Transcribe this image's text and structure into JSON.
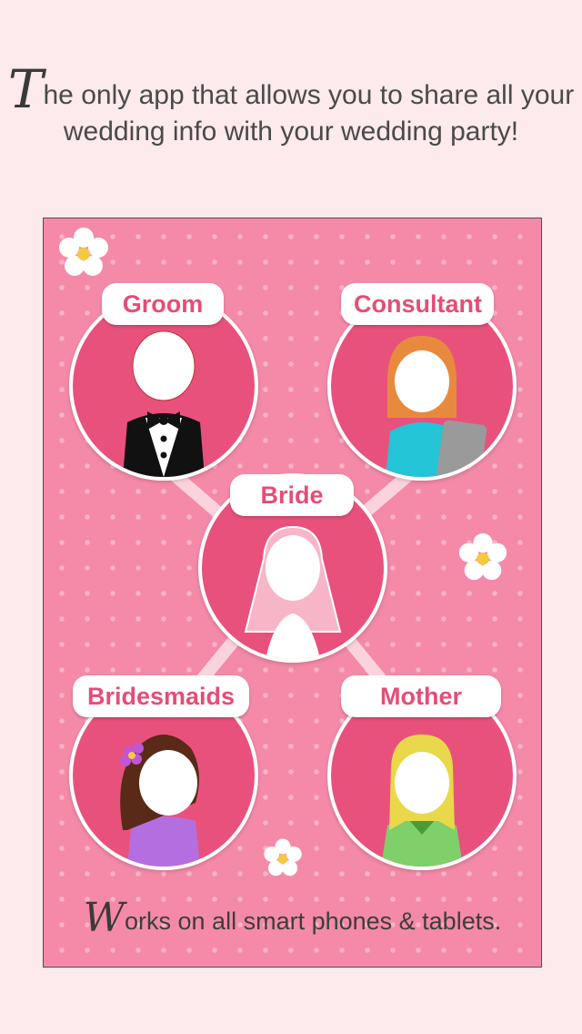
{
  "headline": {
    "initial": "T",
    "rest": "he only app that allows you to share all your wedding info with your wedding party!"
  },
  "roles": {
    "groom": "Groom",
    "consultant": "Consultant",
    "bride": "Bride",
    "bridesmaids": "Bridesmaids",
    "mother": "Mother"
  },
  "footer": {
    "initial": "W",
    "rest": "orks on all smart phones & tablets."
  },
  "colors": {
    "page_background": "#fdeaec",
    "panel_background": "#f48aa8",
    "circle_fill": "#e9517d",
    "label_text": "#e54d77"
  },
  "icons": [
    "flower-icon",
    "groom-avatar-icon",
    "consultant-avatar-icon",
    "bride-avatar-icon",
    "bridesmaid-avatar-icon",
    "mother-avatar-icon"
  ]
}
